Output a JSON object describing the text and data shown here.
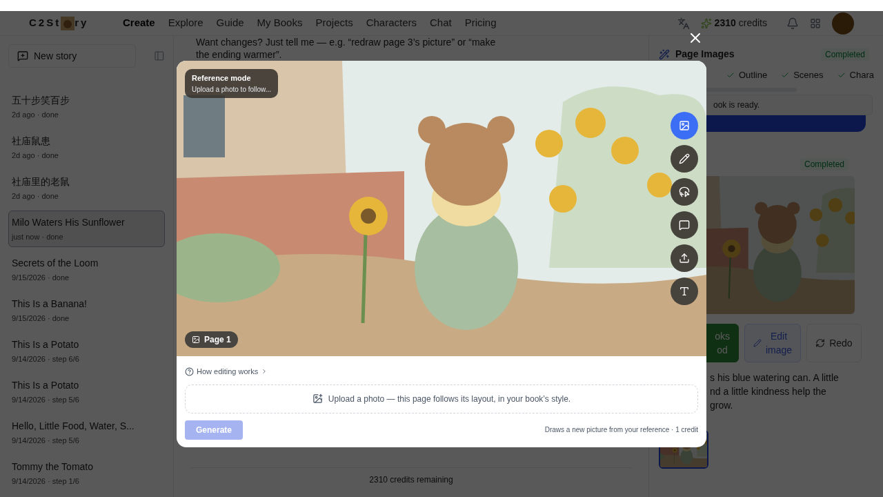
{
  "header": {
    "logo_left": "C2St",
    "logo_right": "ry",
    "nav": [
      {
        "label": "Create",
        "selected": true
      },
      {
        "label": "Explore",
        "selected": false
      },
      {
        "label": "Guide",
        "selected": false
      },
      {
        "label": "My Books",
        "selected": false
      },
      {
        "label": "Projects",
        "selected": false
      },
      {
        "label": "Characters",
        "selected": false
      },
      {
        "label": "Chat",
        "selected": false
      },
      {
        "label": "Pricing",
        "selected": false
      }
    ],
    "credits_value": "2310",
    "credits_label": "credits"
  },
  "sidebar": {
    "new_story": "New story",
    "stories": [
      {
        "title": "五十步笑百步",
        "meta": "2d ago · done",
        "selected": false
      },
      {
        "title": "社庙鼠患",
        "meta": "2d ago · done",
        "selected": false
      },
      {
        "title": "社庙里的老鼠",
        "meta": "2d ago · done",
        "selected": false
      },
      {
        "title": "Milo Waters His Sunflower",
        "meta": "just now · done",
        "selected": true
      },
      {
        "title": "Secrets of the Loom",
        "meta": "9/15/2026 · done",
        "selected": false
      },
      {
        "title": "This Is a Banana!",
        "meta": "9/15/2026 · done",
        "selected": false
      },
      {
        "title": "This Is a Potato",
        "meta": "9/14/2026 · step 6/6",
        "selected": false
      },
      {
        "title": "This Is a Potato",
        "meta": "9/14/2026 · step 5/6",
        "selected": false
      },
      {
        "title": "Hello, Little Food, Water, S...",
        "meta": "9/14/2026 · step 5/6",
        "selected": false
      },
      {
        "title": "Tommy the Tomato",
        "meta": "9/14/2026 · step 1/6",
        "selected": false
      }
    ]
  },
  "chat": {
    "message_lines": [
      "Want changes? Just tell me — e.g. “redraw page 3’s picture” or “make",
      "the ending warmer”."
    ],
    "credits_remaining": "2310 credits remaining"
  },
  "right_panel": {
    "title": "Page Images",
    "status": "Completed",
    "steps": [
      "Outline",
      "Scenes",
      "Chara"
    ],
    "notice": "ook is ready.",
    "card_status": "Completed",
    "buttons": [
      {
        "kind": "approve",
        "lines": [
          "oks",
          "od"
        ]
      },
      {
        "kind": "edit",
        "lines": [
          "Edit",
          "image"
        ]
      },
      {
        "kind": "redo",
        "lines": [
          "Redo"
        ]
      }
    ],
    "caption_lines": [
      "s his blue watering can. A little",
      "nd a little kindness help the",
      "grow."
    ],
    "thumbnails": [
      {
        "selected": true
      }
    ]
  },
  "modal": {
    "mode_title": "Reference mode",
    "mode_hint": "Upload a photo to follow...",
    "page_label": "Page 1",
    "tools": [
      {
        "kind": "reference",
        "selected": true
      },
      {
        "kind": "draw",
        "selected": false
      },
      {
        "kind": "select",
        "selected": false
      },
      {
        "kind": "comment",
        "selected": false
      },
      {
        "kind": "upload",
        "selected": false
      },
      {
        "kind": "text",
        "selected": false
      }
    ],
    "help_link": "How editing works",
    "upload_prompt": "Upload a photo — this page follows its layout, in your book’s style.",
    "generate": {
      "label": "Generate",
      "disabled": true
    },
    "footnote": "Draws a new picture from your reference · 1 credit"
  }
}
